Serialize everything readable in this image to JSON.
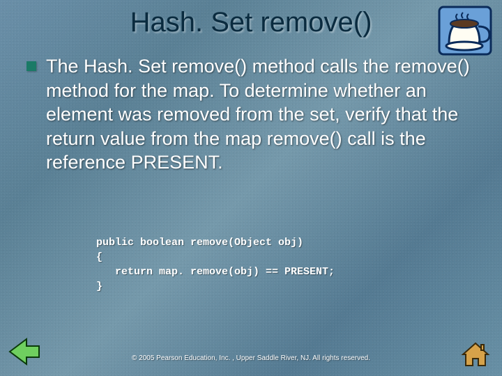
{
  "title": "Hash. Set remove()",
  "body_text": "The Hash. Set remove() method calls the remove() method for the map. To determine whether an element was removed from the set, verify that the return value from the map remove() call is the reference PRESENT.",
  "code": "public boolean remove(Object obj)\n{\n   return map. remove(obj) == PRESENT;\n}",
  "copyright": "© 2005 Pearson Education, Inc. , Upper Saddle River, NJ.  All rights reserved.",
  "icons": {
    "coffee": "coffee-cup-icon",
    "back": "back-arrow-icon",
    "home": "home-icon"
  }
}
